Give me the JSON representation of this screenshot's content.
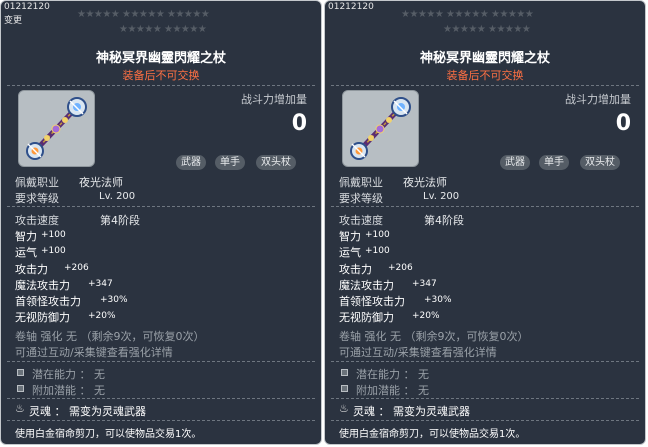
{
  "tooltips": [
    {
      "item_id": "01212120",
      "change_label": "变更",
      "stars_row1": "★★★★★ ★★★★★ ★★★★★",
      "stars_row2": "★★★★★ ★★★★★",
      "title": "神秘冥界幽靈閃耀之杖",
      "trade_warning": "装备后不可交换",
      "power_label": "战斗力增加量",
      "power_value": "0",
      "tags": [
        "武器",
        "单手",
        "双头杖"
      ],
      "job_label": "佩戴职业",
      "job_value": "夜光法师",
      "level_label": "要求等级",
      "level_value": "Lv. 200",
      "attack_speed_label": "攻击速度",
      "attack_speed_value": "第4阶段",
      "stats": [
        {
          "label": "智力",
          "value": "+100"
        },
        {
          "label": "运气",
          "value": "+100"
        },
        {
          "label": "攻击力",
          "value": "+206"
        },
        {
          "label": "魔法攻击力",
          "value": "+347"
        },
        {
          "label": "首领怪攻击力",
          "value": "+30%"
        },
        {
          "label": "无视防御力",
          "value": "+20%"
        }
      ],
      "scroll_text": "卷轴 强化 无 （剩余9次，可恢复0次）",
      "enhance_hint": "可通过互动/采集键查看强化详情",
      "potential_label": "潜在能力 ： 无",
      "additional_potential_label": "附加潜能 ： 无",
      "soul_label": "灵魂 ： 需变为灵魂武器",
      "scissors_text": "使用白金宿命剪刀，可以使物品交易1次。"
    },
    {
      "item_id": "01212120",
      "change_label": "",
      "stars_row1": "★★★★★ ★★★★★ ★★★★★",
      "stars_row2": "★★★★★ ★★★★★",
      "title": "神秘冥界幽靈閃耀之杖",
      "trade_warning": "装备后不可交换",
      "power_label": "战斗力增加量",
      "power_value": "0",
      "tags": [
        "武器",
        "单手",
        "双头杖"
      ],
      "job_label": "佩戴职业",
      "job_value": "夜光法师",
      "level_label": "要求等级",
      "level_value": "Lv. 200",
      "attack_speed_label": "攻击速度",
      "attack_speed_value": "第4阶段",
      "stats": [
        {
          "label": "智力",
          "value": "+100"
        },
        {
          "label": "运气",
          "value": "+100"
        },
        {
          "label": "攻击力",
          "value": "+206"
        },
        {
          "label": "魔法攻击力",
          "value": "+347"
        },
        {
          "label": "首领怪攻击力",
          "value": "+30%"
        },
        {
          "label": "无视防御力",
          "value": "+20%"
        }
      ],
      "scroll_text": "卷轴 强化 无 （剩余9次，可恢复0次）",
      "enhance_hint": "可通过互动/采集键查看强化详情",
      "potential_label": "潜在能力 ： 无",
      "additional_potential_label": "附加潜能 ： 无",
      "soul_label": "灵魂 ： 需变为灵魂武器",
      "scissors_text": "使用白金宿命剪刀，可以使物品交易1次。"
    }
  ],
  "colors": {
    "panel_bg": "#2b3340",
    "warning": "#ff7043",
    "muted_text": "#9aa1a8"
  },
  "icons": {
    "item": "ornate-double-headed-staff-icon",
    "potential": "potential-square-icon",
    "soul": "soul-flame-icon"
  }
}
